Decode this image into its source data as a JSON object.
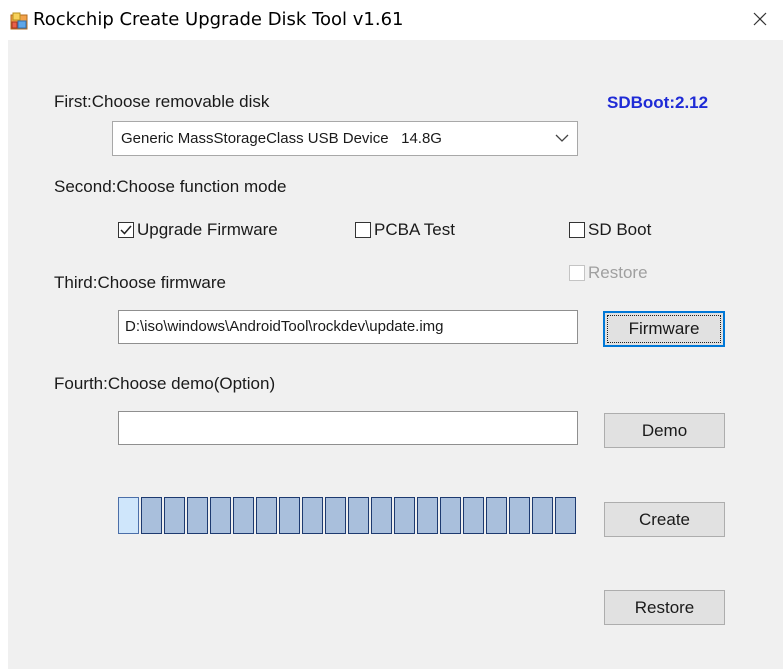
{
  "window": {
    "title": "Rockchip Create Upgrade Disk Tool v1.61"
  },
  "step1": {
    "label": "First:Choose removable disk",
    "sdboot_version": "SDBoot:2.12",
    "disk_selected": "Generic MassStorageClass USB Device   14.8G"
  },
  "step2": {
    "label": "Second:Choose function mode",
    "options": [
      {
        "label": "Upgrade Firmware",
        "checked": true,
        "enabled": true
      },
      {
        "label": "PCBA Test",
        "checked": false,
        "enabled": true
      },
      {
        "label": "SD Boot",
        "checked": false,
        "enabled": true
      },
      {
        "label": "Restore",
        "checked": false,
        "enabled": false
      }
    ]
  },
  "step3": {
    "label": "Third:Choose firmware",
    "firmware_path": "D:\\iso\\windows\\AndroidTool\\rockdev\\update.img",
    "firmware_button": "Firmware"
  },
  "step4": {
    "label": "Fourth:Choose demo(Option)",
    "demo_path": "",
    "demo_button": "Demo"
  },
  "progress": {
    "segments_total": 20,
    "segments_filled": 1
  },
  "actions": {
    "create_button": "Create",
    "restore_button": "Restore"
  },
  "colors": {
    "sdboot_text": "#1f2bd6",
    "progress_segment": "#a9bfdc",
    "progress_segment_border": "#1d3a70",
    "client_background": "#f0f0f0",
    "focus_border": "#0078d7"
  },
  "icons": {
    "app": "rockchip-app-icon",
    "close": "close-icon",
    "dropdown": "chevron-down-icon"
  }
}
